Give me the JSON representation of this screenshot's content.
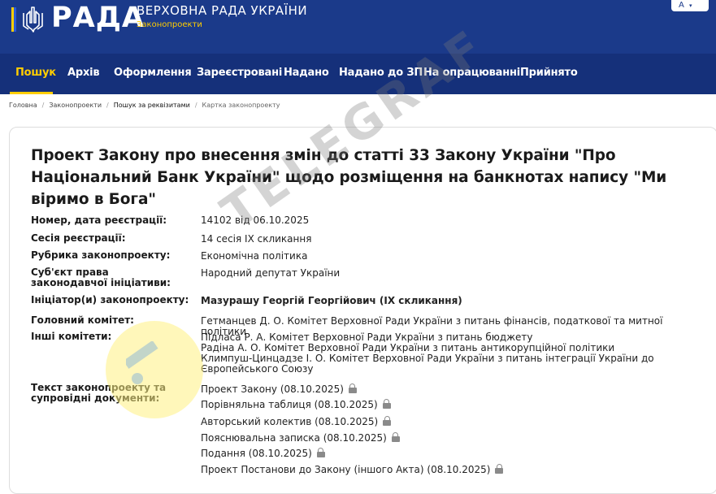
{
  "header": {
    "logo_text": "РАДА",
    "site_title": "ВЕРХОВНА РАДА УКРАЇНИ",
    "site_subtitle": "Законопроекти",
    "lang_label": "A"
  },
  "nav": {
    "items": [
      {
        "label": "Пошук"
      },
      {
        "label": "Архів"
      },
      {
        "label": "Оформлення"
      },
      {
        "label": "Зареєстровані"
      },
      {
        "label": "Надано"
      },
      {
        "label": "Надано до ЗП"
      },
      {
        "label": "На опрацюванні"
      },
      {
        "label": "Прийнято"
      }
    ]
  },
  "breadcrumb": [
    "Головна",
    "Законопроекти",
    "Пошук за реквізитами",
    "Картка законопроекту"
  ],
  "bill": {
    "title": "Проект Закону про внесення змін до статті 33 Закону України \"Про Національний Банк України\" щодо розміщення на банкнотах напису \"Ми віримо в Бога\"",
    "fields": {
      "reg_label": "Номер, дата реєстрації:",
      "reg_value": "14102 від 06.10.2025",
      "session_label": "Сесія реєстрації:",
      "session_value": "14 сесія IX скликання",
      "rubric_label": "Рубрика законопроекту:",
      "rubric_value": "Економічна політика",
      "subject_label": "Суб'єкт права законодавчої ініціативи:",
      "subject_value": "Народний депутат України",
      "initiator_label": "Ініціатор(и) законопроекту:",
      "initiator_value": "Мазурашу Георгій Георгійович (IX скликання)",
      "main_committee_label": "Головний комітет:",
      "main_committee_value": "Гетманцев Д. О. Комітет Верховної Ради України з питань фінансів, податкової та митної політики",
      "other_committees_label": "Інші комітети:",
      "other_committees": [
        "Підласа Р. А. Комітет Верховної Ради України з питань бюджету",
        "Радіна А. О. Комітет Верховної Ради України з питань антикорупційної політики",
        "Климпуш-Цинцадзе І. О. Комітет Верховної Ради України з питань інтеграції України до Європейського Союзу"
      ],
      "docs_label": "Текст законопроекту та супровідні документи:",
      "docs": [
        "Проект Закону (08.10.2025)",
        "Порівняльна таблиця (08.10.2025)",
        "Авторський колектив (08.10.2025)",
        "Пояснювальна записка (08.10.2025)",
        "Подання (08.10.2025)",
        "Проект Постанови до Закону (іншого Акта) (08.10.2025)"
      ]
    }
  },
  "watermark": {
    "text": "TELEGRAF"
  },
  "colors": {
    "header_bg": "#1b3a8a",
    "nav_bg": "#15307a",
    "accent_yellow": "#ffcd00",
    "lock_gray": "#8a8a8a"
  },
  "icons": [
    "trident-icon",
    "lock-icon"
  ]
}
